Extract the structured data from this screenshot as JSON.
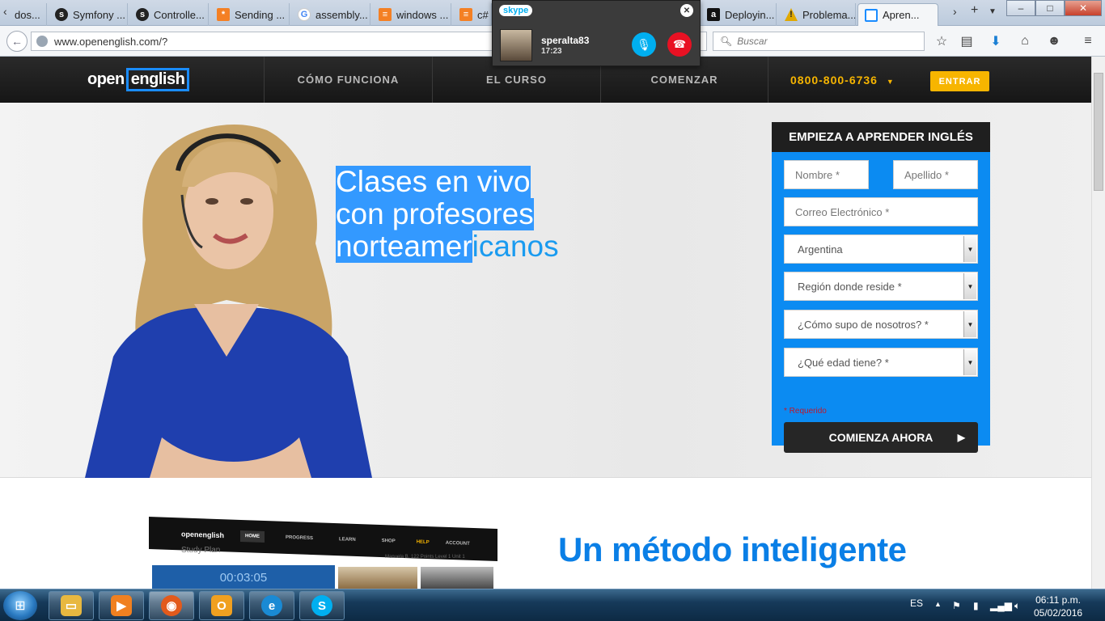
{
  "browser": {
    "tabs": [
      {
        "label": "dos...",
        "icon_color": "#7a7a7a"
      },
      {
        "label": "Symfony ...",
        "icon_color": "#222222"
      },
      {
        "label": "Controlle...",
        "icon_color": "#222222"
      },
      {
        "label": "Sending ...",
        "icon_color": "#f48024"
      },
      {
        "label": "assembly...",
        "icon_color": "#4285f4"
      },
      {
        "label": "windows ...",
        "icon_color": "#f48024"
      },
      {
        "label": "c# ...",
        "icon_color": "#f48024"
      },
      {
        "label": "Deployin...",
        "icon_color": "#111111"
      },
      {
        "label": "Problema...",
        "icon_color": "#e0a800"
      },
      {
        "label": "Apren...",
        "icon_color": "#1a8cff"
      }
    ],
    "url": "www.openenglish.com/?",
    "search_placeholder": "Buscar",
    "window_buttons": {
      "minimize": "–",
      "maximize": "□",
      "close": "✕"
    }
  },
  "site": {
    "logo": {
      "left": "open",
      "right": "english"
    },
    "nav": [
      "CÓMO FUNCIONA",
      "EL CURSO",
      "COMENZAR"
    ],
    "phone": "0800-800-6736",
    "login_button": "ENTRAR"
  },
  "hero": {
    "headline": [
      "Clases en vivo",
      "con profesores",
      "norteamer",
      "icanos"
    ]
  },
  "signup_form": {
    "title": "EMPIEZA A APRENDER INGLÉS",
    "first_name_placeholder": "Nombre *",
    "last_name_placeholder": "Apellido *",
    "email_placeholder": "Correo Electrónico *",
    "country_selected": "Argentina",
    "region_selected": "Región donde reside *",
    "source_selected": "¿Cómo supo de nosotros? *",
    "age_selected": "¿Qué edad tiene? *",
    "required_note": "* Requerido",
    "submit_label": "COMIENZA AHORA"
  },
  "section2": {
    "title": "Un método inteligente",
    "preview": {
      "logo": "openenglish",
      "tabs": [
        "HOME",
        "PROGRESS",
        "LEARN",
        "SHOP"
      ],
      "help": "HELP",
      "account": "ACCOUNT",
      "study_plan": "Study Plan",
      "timer": "00:03:05",
      "meta": "Manuela B.  122 Points  Level 1  Unit 1"
    }
  },
  "skype": {
    "logo": "skype",
    "caller": "speralta83",
    "duration": "17:23"
  },
  "taskbar": {
    "language": "ES",
    "time": "06:11 p.m.",
    "date": "05/02/2016",
    "apps": [
      {
        "name": "explorer",
        "color": "#e8b840"
      },
      {
        "name": "media-player",
        "color": "#f08020"
      },
      {
        "name": "firefox",
        "color": "#e25a1c"
      },
      {
        "name": "outlook",
        "color": "#f0a020"
      },
      {
        "name": "internet-explorer",
        "color": "#1a8ad4"
      },
      {
        "name": "skype",
        "color": "#00aff0"
      }
    ]
  }
}
